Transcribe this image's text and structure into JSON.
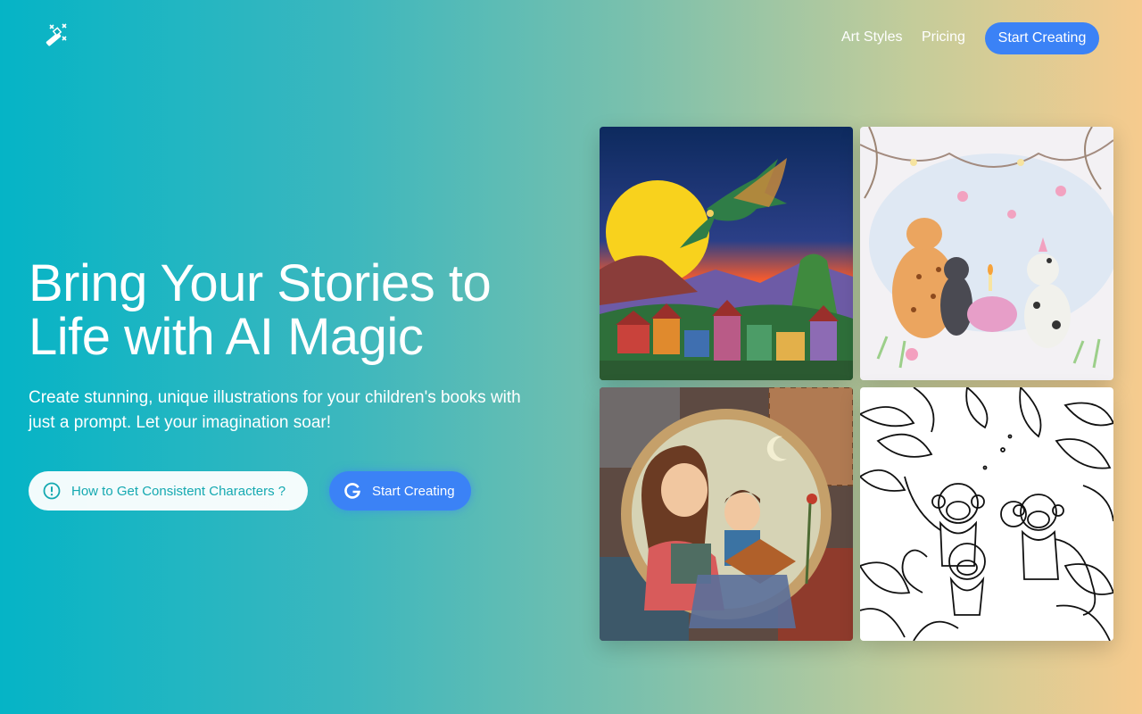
{
  "nav": {
    "logo_icon": "magic-wand-icon",
    "links": [
      "Art Styles",
      "Pricing"
    ],
    "cta_label": "Start Creating"
  },
  "hero": {
    "title_line1": "Bring Your Stories to",
    "title_line2": "Life with AI Magic",
    "subtitle_line1": "Create stunning, unique illustrations for your children's books with",
    "subtitle_line2": "just a prompt. Let your imagination soar!",
    "help_button": {
      "label": "How to Get Consistent Characters ?",
      "icon": "info-circle-icon"
    },
    "start_button": {
      "label": "Start Creating",
      "icon": "google-g-icon"
    }
  },
  "gallery": {
    "images": [
      {
        "subject": "dragon-over-village",
        "icon": "dragon-image"
      },
      {
        "subject": "animal-tea-party",
        "icon": "animals-image"
      },
      {
        "subject": "mother-reading-to-child",
        "icon": "reading-image"
      },
      {
        "subject": "monkeys-coloring-page",
        "icon": "monkeys-image"
      }
    ]
  },
  "colors": {
    "accent": "#3b82f6",
    "teal_text": "#15a9b1",
    "bg_left": "#05b4c6",
    "bg_right": "#f6cb8e"
  }
}
